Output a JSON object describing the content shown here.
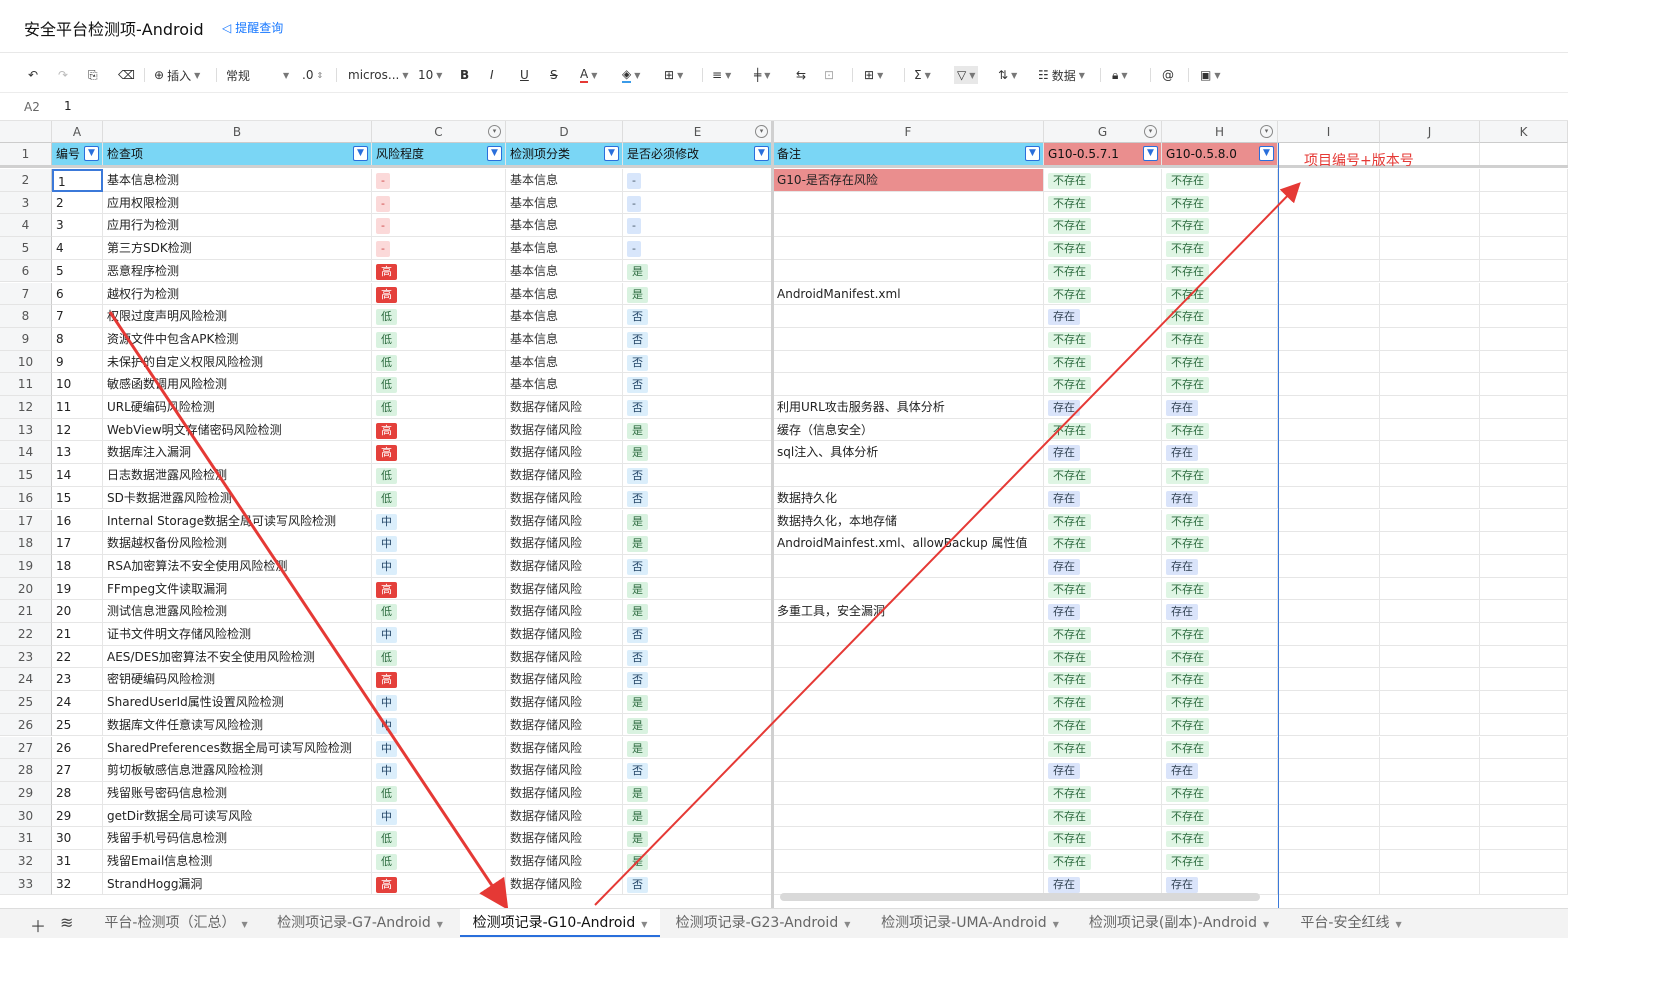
{
  "header": {
    "title": "安全平台检测项-Android",
    "remind_label": "提醒查询"
  },
  "toolbar": {
    "insert_label": "插入",
    "format_label": "常规",
    "decimal_label": ".0",
    "font_label": "micros...",
    "font_size": "10",
    "data_label": "数据"
  },
  "formula": {
    "cell_ref": "A2",
    "value": "1"
  },
  "columns": [
    "A",
    "B",
    "C",
    "D",
    "E",
    "F",
    "G",
    "H",
    "I",
    "J",
    "K"
  ],
  "header_row": {
    "a": "编号",
    "b": "检查项",
    "c": "风险程度",
    "d": "检测项分类",
    "e": "是否必须修改",
    "f": "备注",
    "g": "G10-0.5.7.1",
    "h": "G10-0.5.8.0"
  },
  "annotation": "项目编号+版本号",
  "rows": [
    {
      "r": "2",
      "no": "1",
      "item": "基本信息检测",
      "risk": "-",
      "cat": "基本信息",
      "must": "-",
      "note": "G10-是否存在风险",
      "g": "不存在",
      "h": "不存在"
    },
    {
      "r": "3",
      "no": "2",
      "item": "应用权限检测",
      "risk": "-",
      "cat": "基本信息",
      "must": "-",
      "note": "",
      "g": "不存在",
      "h": "不存在"
    },
    {
      "r": "4",
      "no": "3",
      "item": "应用行为检测",
      "risk": "-",
      "cat": "基本信息",
      "must": "-",
      "note": "",
      "g": "不存在",
      "h": "不存在"
    },
    {
      "r": "5",
      "no": "4",
      "item": "第三方SDK检测",
      "risk": "-",
      "cat": "基本信息",
      "must": "-",
      "note": "",
      "g": "不存在",
      "h": "不存在"
    },
    {
      "r": "6",
      "no": "5",
      "item": "恶意程序检测",
      "risk": "高",
      "cat": "基本信息",
      "must": "是",
      "note": "",
      "g": "不存在",
      "h": "不存在"
    },
    {
      "r": "7",
      "no": "6",
      "item": " 越权行为检测",
      "risk": "高",
      "cat": "基本信息",
      "must": "是",
      "note": "AndroidManifest.xml",
      "g": "不存在",
      "h": "不存在"
    },
    {
      "r": "8",
      "no": "7",
      "item": "权限过度声明风险检测",
      "risk": "低",
      "cat": "基本信息",
      "must": "否",
      "note": "",
      "g": "存在",
      "h": "不存在"
    },
    {
      "r": "9",
      "no": "8",
      "item": "资源文件中包含APK检测",
      "risk": "低",
      "cat": "基本信息",
      "must": "否",
      "note": "",
      "g": "不存在",
      "h": "不存在"
    },
    {
      "r": "10",
      "no": "9",
      "item": "未保护的自定义权限风险检测",
      "risk": "低",
      "cat": "基本信息",
      "must": "否",
      "note": "",
      "g": "不存在",
      "h": "不存在"
    },
    {
      "r": "11",
      "no": "10",
      "item": "敏感函数调用风险检测",
      "risk": "低",
      "cat": "基本信息",
      "must": "否",
      "note": "",
      "g": "不存在",
      "h": "不存在"
    },
    {
      "r": "12",
      "no": "11",
      "item": "URL硬编码风险检测",
      "risk": "低",
      "cat": "数据存储风险",
      "must": "否",
      "note": "利用URL攻击服务器、具体分析",
      "g": "存在",
      "h": "存在"
    },
    {
      "r": "13",
      "no": "12",
      "item": "WebView明文存储密码风险检测",
      "risk": "高",
      "cat": "数据存储风险",
      "must": "是",
      "note": "缓存（信息安全）",
      "g": "不存在",
      "h": "不存在"
    },
    {
      "r": "14",
      "no": "13",
      "item": "数据库注入漏洞",
      "risk": "高",
      "cat": "数据存储风险",
      "must": "是",
      "note": "sql注入、具体分析",
      "g": "存在",
      "h": "存在"
    },
    {
      "r": "15",
      "no": "14",
      "item": "日志数据泄露风险检测",
      "risk": "低",
      "cat": "数据存储风险",
      "must": "否",
      "note": "",
      "g": "不存在",
      "h": "不存在"
    },
    {
      "r": "16",
      "no": "15",
      "item": "SD卡数据泄露风险检测",
      "risk": "低",
      "cat": "数据存储风险",
      "must": "否",
      "note": "数据持久化",
      "g": "存在",
      "h": "存在"
    },
    {
      "r": "17",
      "no": "16",
      "item": "Internal Storage数据全局可读写风险检测",
      "risk": "中",
      "cat": "数据存储风险",
      "must": "是",
      "note": "数据持久化，本地存储",
      "g": "不存在",
      "h": "不存在"
    },
    {
      "r": "18",
      "no": "17",
      "item": "数据越权备份风险检测",
      "risk": "中",
      "cat": "数据存储风险",
      "must": "是",
      "note": "AndroidMainfest.xml、allowBackup 属性值",
      "g": "不存在",
      "h": "不存在"
    },
    {
      "r": "19",
      "no": "18",
      "item": "RSA加密算法不安全使用风险检测",
      "risk": "中",
      "cat": "数据存储风险",
      "must": "否",
      "note": "",
      "g": "存在",
      "h": "存在"
    },
    {
      "r": "20",
      "no": "19",
      "item": "FFmpeg文件读取漏洞",
      "risk": "高",
      "cat": "数据存储风险",
      "must": "是",
      "note": "",
      "g": "不存在",
      "h": "不存在"
    },
    {
      "r": "21",
      "no": "20",
      "item": "测试信息泄露风险检测",
      "risk": "低",
      "cat": "数据存储风险",
      "must": "是",
      "note": "多重工具，安全漏洞",
      "g": "存在",
      "h": "存在"
    },
    {
      "r": "22",
      "no": "21",
      "item": "证书文件明文存储风险检测",
      "risk": "中",
      "cat": "数据存储风险",
      "must": "否",
      "note": "",
      "g": "不存在",
      "h": "不存在"
    },
    {
      "r": "23",
      "no": "22",
      "item": "AES/DES加密算法不安全使用风险检测",
      "risk": "低",
      "cat": "数据存储风险",
      "must": "否",
      "note": "",
      "g": "不存在",
      "h": "不存在"
    },
    {
      "r": "24",
      "no": "23",
      "item": "密钥硬编码风险检测",
      "risk": "高",
      "cat": "数据存储风险",
      "must": "否",
      "note": "",
      "g": "不存在",
      "h": "不存在"
    },
    {
      "r": "25",
      "no": "24",
      "item": "SharedUserId属性设置风险检测",
      "risk": "中",
      "cat": "数据存储风险",
      "must": "是",
      "note": "",
      "g": "不存在",
      "h": "不存在"
    },
    {
      "r": "26",
      "no": "25",
      "item": "数据库文件任意读写风险检测",
      "risk": "中",
      "cat": "数据存储风险",
      "must": "是",
      "note": "",
      "g": "不存在",
      "h": "不存在"
    },
    {
      "r": "27",
      "no": "26",
      "item": "SharedPreferences数据全局可读写风险检测",
      "risk": "中",
      "cat": "数据存储风险",
      "must": "是",
      "note": "",
      "g": "不存在",
      "h": "不存在"
    },
    {
      "r": "28",
      "no": "27",
      "item": "剪切板敏感信息泄露风险检测",
      "risk": "中",
      "cat": "数据存储风险",
      "must": "否",
      "note": "",
      "g": "存在",
      "h": "存在"
    },
    {
      "r": "29",
      "no": "28",
      "item": "残留账号密码信息检测",
      "risk": "低",
      "cat": "数据存储风险",
      "must": "是",
      "note": "",
      "g": "不存在",
      "h": "不存在"
    },
    {
      "r": "30",
      "no": "29",
      "item": "getDir数据全局可读写风险",
      "risk": "中",
      "cat": "数据存储风险",
      "must": "是",
      "note": "",
      "g": "不存在",
      "h": "不存在"
    },
    {
      "r": "31",
      "no": "30",
      "item": "残留手机号码信息检测",
      "risk": "低",
      "cat": "数据存储风险",
      "must": "是",
      "note": "",
      "g": "不存在",
      "h": "不存在"
    },
    {
      "r": "32",
      "no": "31",
      "item": "残留Email信息检测",
      "risk": "低",
      "cat": "数据存储风险",
      "must": "是",
      "note": "",
      "g": "不存在",
      "h": "不存在"
    },
    {
      "r": "33",
      "no": "32",
      "item": "StrandHogg漏洞",
      "risk": "高",
      "cat": "数据存储风险",
      "must": "否",
      "note": "",
      "g": "存在",
      "h": "存在"
    }
  ],
  "sheet_tabs": [
    {
      "label": "平台-检测项（汇总）",
      "active": false
    },
    {
      "label": "检测项记录-G7-Android",
      "active": false
    },
    {
      "label": "检测项记录-G10-Android",
      "active": true
    },
    {
      "label": "检测项记录-G23-Android",
      "active": false
    },
    {
      "label": "检测项记录-UMA-Android",
      "active": false
    },
    {
      "label": "检测项记录(副本)-Android",
      "active": false
    },
    {
      "label": "平台-安全红线",
      "active": false
    }
  ],
  "colors": {
    "header_blue": "#7ad6f5",
    "header_red": "#ea8e8e",
    "arrow_red": "#e53935",
    "selection_blue": "#3b79d9"
  }
}
